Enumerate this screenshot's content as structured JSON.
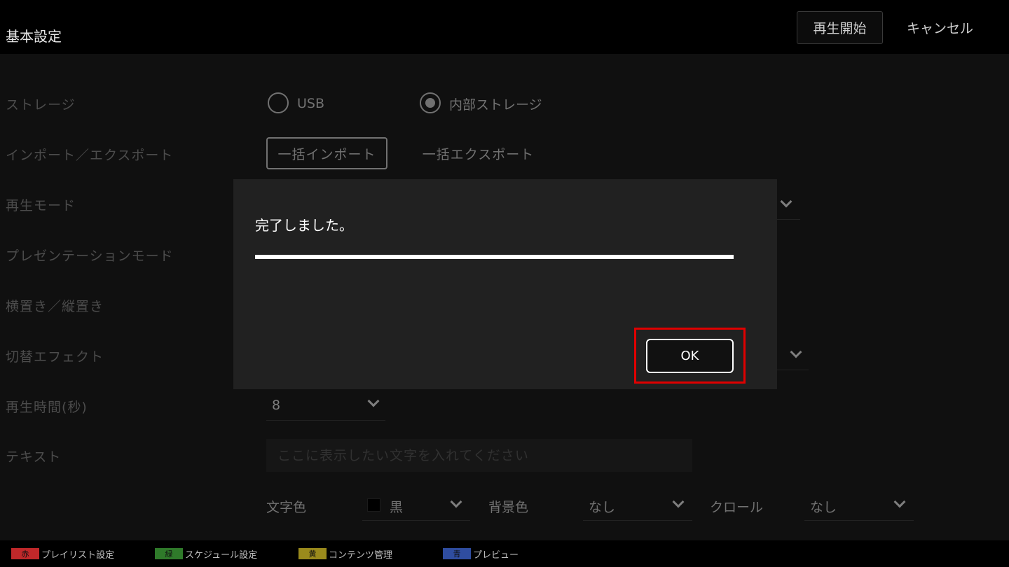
{
  "header": {
    "title": "基本設定",
    "start_label": "再生開始",
    "cancel_label": "キャンセル"
  },
  "settings": {
    "storage": {
      "label": "ストレージ",
      "options": [
        "USB",
        "内部ストレージ"
      ],
      "selected": "内部ストレージ"
    },
    "import_export": {
      "label": "インポート／エクスポート",
      "import_label": "一括インポート",
      "export_label": "一括エクスポート"
    },
    "play_mode": {
      "label": "再生モード"
    },
    "presentation_mode": {
      "label": "プレゼンテーションモード"
    },
    "orientation": {
      "label": "横置き／縦置き"
    },
    "transition_effect": {
      "label": "切替エフェクト"
    },
    "play_time": {
      "label": "再生時間(秒)",
      "value": "8"
    },
    "text": {
      "label": "テキスト",
      "placeholder": "ここに表示したい文字を入れてください"
    },
    "text_color": {
      "label": "文字色",
      "value": "黒"
    },
    "bg_color": {
      "label": "背景色",
      "value": "なし"
    },
    "scroll": {
      "label": "クロール",
      "value": "なし"
    }
  },
  "dialog": {
    "message": "完了しました。",
    "progress": 1.0,
    "ok_label": "OK"
  },
  "footer": {
    "keys": [
      {
        "key": "赤",
        "label": "プレイリスト設定",
        "color": "#c0282a"
      },
      {
        "key": "緑",
        "label": "スケジュール設定",
        "color": "#2f7a2a"
      },
      {
        "key": "黄",
        "label": "コンテンツ管理",
        "color": "#9a8a1c"
      },
      {
        "key": "青",
        "label": "プレビュー",
        "color": "#2f4da0"
      }
    ]
  }
}
